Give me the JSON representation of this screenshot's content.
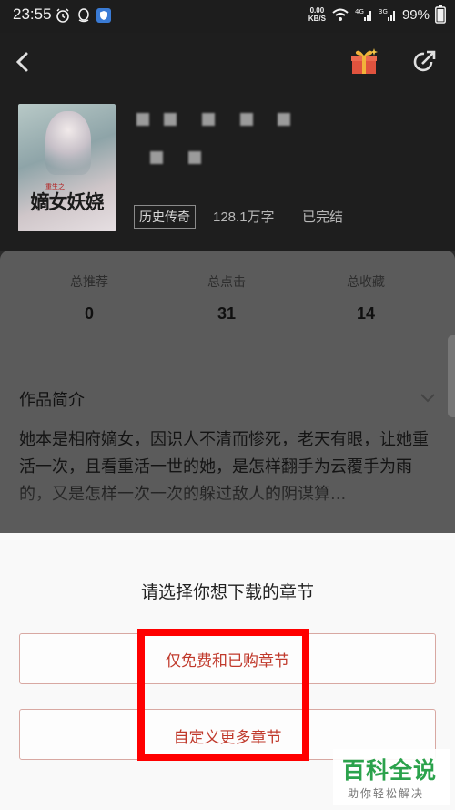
{
  "status_bar": {
    "time": "23:55",
    "net_speed_value": "0.00",
    "net_speed_unit": "KB/S",
    "signal_4g": "4G",
    "signal_3g": "3G",
    "battery": "99%"
  },
  "nav": {
    "back_icon": "chevron-left-icon",
    "gift_icon": "gift-icon",
    "share_icon": "share-icon"
  },
  "book": {
    "cover_title": "嫡女妖娆",
    "cover_label": "重生之",
    "genre": "历史传奇",
    "word_count": "128.1万字",
    "status": "已完结"
  },
  "stats": [
    {
      "label": "总推荐",
      "value": "0"
    },
    {
      "label": "总点击",
      "value": "31"
    },
    {
      "label": "总收藏",
      "value": "14"
    }
  ],
  "intro": {
    "title": "作品简介",
    "text": "她本是相府嫡女，因识人不清而惨死，老天有眼，让她重活一次，且看重活一世的她，是怎样翻手为云覆手为雨的，又是怎样一次一次的躲过敌人的阴谋算..."
  },
  "sheet": {
    "title": "请选择你想下载的章节",
    "option_free": "仅免费和已购章节",
    "option_custom": "自定义更多章节"
  },
  "watermark": {
    "main": "百科全说",
    "sub": "助你轻松解决"
  },
  "colors": {
    "accent": "#c0392b",
    "highlight": "#ff0000",
    "watermark": "#2ba24c"
  }
}
